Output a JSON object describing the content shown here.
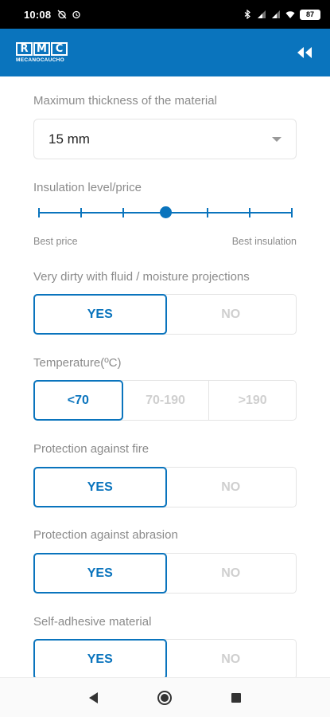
{
  "status_bar": {
    "time": "10:08",
    "battery": "87",
    "icons": [
      "alarm-off-icon",
      "alarm-icon",
      "bluetooth-icon",
      "signal-icon",
      "signal-icon",
      "wifi-icon",
      "battery-icon"
    ]
  },
  "app_bar": {
    "logo_letters": [
      "R",
      "M",
      "C"
    ],
    "logo_subtitle": "MECANOCAUCHO",
    "collapse_icon": "double-chevron-left-icon"
  },
  "form": {
    "thickness": {
      "label": "Maximum thickness of the material",
      "value": "15 mm"
    },
    "insulation": {
      "label": "Insulation level/price",
      "steps": 7,
      "selected_step": 4,
      "min_label": "Best price",
      "max_label": "Best insulation"
    },
    "dirty": {
      "label": "Very dirty with fluid / moisture projections",
      "options": [
        "YES",
        "NO"
      ],
      "selected": "YES"
    },
    "temperature": {
      "label": "Temperature(ºC)",
      "options": [
        "<70",
        "70-190",
        ">190"
      ],
      "selected": "<70"
    },
    "fire": {
      "label": "Protection against fire",
      "options": [
        "YES",
        "NO"
      ],
      "selected": "YES"
    },
    "abrasion": {
      "label": "Protection against abrasion",
      "options": [
        "YES",
        "NO"
      ],
      "selected": "YES"
    },
    "adhesive": {
      "label": "Self-adhesive material",
      "options": [
        "YES",
        "NO"
      ],
      "selected": "YES"
    }
  },
  "colors": {
    "accent": "#0a74bd",
    "muted_text": "#8b8b8b",
    "unselected_option": "#cfcfcf"
  }
}
